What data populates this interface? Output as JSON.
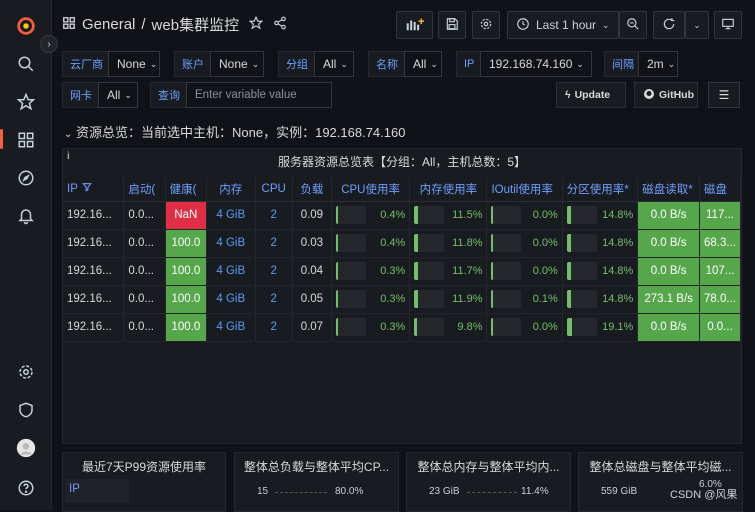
{
  "header": {
    "folder": "General",
    "separator": "/",
    "dashboard_title": "web集群监控",
    "time_range": "Last 1 hour"
  },
  "variables": {
    "row1": [
      {
        "label": "云厂商",
        "value": "None"
      },
      {
        "label": "账户",
        "value": "None"
      },
      {
        "label": "分组",
        "value": "All"
      },
      {
        "label": "名称",
        "value": "All"
      },
      {
        "label": "IP",
        "value": "192.168.74.160"
      },
      {
        "label": "间隔",
        "value": "2m"
      }
    ],
    "row2": [
      {
        "label": "网卡",
        "value": "All"
      },
      {
        "label": "查询",
        "placeholder": "Enter variable value"
      }
    ],
    "update_label": "Update",
    "github_label": "GitHub"
  },
  "row_title": "资源总览：当前选中主机：None，实例：192.168.74.160",
  "table_panel": {
    "info": "i",
    "title": "服务器资源总览表【分组：All，主机总数：5】",
    "columns": [
      "IP",
      "启动(",
      "健康(",
      "内存",
      "CPU",
      "负载",
      "CPU使用率",
      "内存使用率",
      "IOutil使用率",
      "分区使用率*",
      "磁盘读取*",
      "磁盘"
    ],
    "rows": [
      {
        "ip": "192.16...",
        "uptime": "0.0...",
        "health": "NaN",
        "health_ok": false,
        "mem": "4 GiB",
        "cpu": "2",
        "load": "0.09",
        "cpu_pct": "0.4%",
        "cpu_frac": 0.004,
        "mem_pct": "11.5%",
        "mem_frac": 0.115,
        "io_pct": "0.0%",
        "io_frac": 0.0,
        "part_pct": "14.8%",
        "part_frac": 0.148,
        "disk_read": "0.0 B/s",
        "disk_w": "117..."
      },
      {
        "ip": "192.16...",
        "uptime": "0.0...",
        "health": "100.0",
        "health_ok": true,
        "mem": "4 GiB",
        "cpu": "2",
        "load": "0.03",
        "cpu_pct": "0.4%",
        "cpu_frac": 0.004,
        "mem_pct": "11.8%",
        "mem_frac": 0.118,
        "io_pct": "0.0%",
        "io_frac": 0.0,
        "part_pct": "14.8%",
        "part_frac": 0.148,
        "disk_read": "0.0 B/s",
        "disk_w": "68.3..."
      },
      {
        "ip": "192.16...",
        "uptime": "0.0...",
        "health": "100.0",
        "health_ok": true,
        "mem": "4 GiB",
        "cpu": "2",
        "load": "0.04",
        "cpu_pct": "0.3%",
        "cpu_frac": 0.003,
        "mem_pct": "11.7%",
        "mem_frac": 0.117,
        "io_pct": "0.0%",
        "io_frac": 0.0,
        "part_pct": "14.8%",
        "part_frac": 0.148,
        "disk_read": "0.0 B/s",
        "disk_w": "107..."
      },
      {
        "ip": "192.16...",
        "uptime": "0.0...",
        "health": "100.0",
        "health_ok": true,
        "mem": "4 GiB",
        "cpu": "2",
        "load": "0.05",
        "cpu_pct": "0.3%",
        "cpu_frac": 0.003,
        "mem_pct": "11.9%",
        "mem_frac": 0.119,
        "io_pct": "0.1%",
        "io_frac": 0.001,
        "part_pct": "14.8%",
        "part_frac": 0.148,
        "disk_read": "273.1 B/s",
        "disk_w": "78.0..."
      },
      {
        "ip": "192.16...",
        "uptime": "0.0...",
        "health": "100.0",
        "health_ok": true,
        "mem": "4 GiB",
        "cpu": "2",
        "load": "0.07",
        "cpu_pct": "0.3%",
        "cpu_frac": 0.003,
        "mem_pct": "9.8%",
        "mem_frac": 0.098,
        "io_pct": "0.0%",
        "io_frac": 0.0,
        "part_pct": "19.1%",
        "part_frac": 0.191,
        "disk_read": "0.0 B/s",
        "disk_w": "0.0..."
      }
    ]
  },
  "bottom_panels": [
    {
      "title": "最近7天P99资源使用率",
      "col": "IP"
    },
    {
      "title": "整体总负载与整体平均CP...",
      "left": "15",
      "right": "80.0%"
    },
    {
      "title": "整体总内存与整体平均内...",
      "left": "23 GiB",
      "right": "11.4%"
    },
    {
      "title": "整体总磁盘与整体平均磁...",
      "left": "559 GiB",
      "right": "6.0%"
    }
  ],
  "watermark": "CSDN @风果",
  "colors": {
    "accent": "#f55f3e",
    "green": "#56a64b",
    "red": "#e02f44",
    "link": "#6e9fff"
  }
}
